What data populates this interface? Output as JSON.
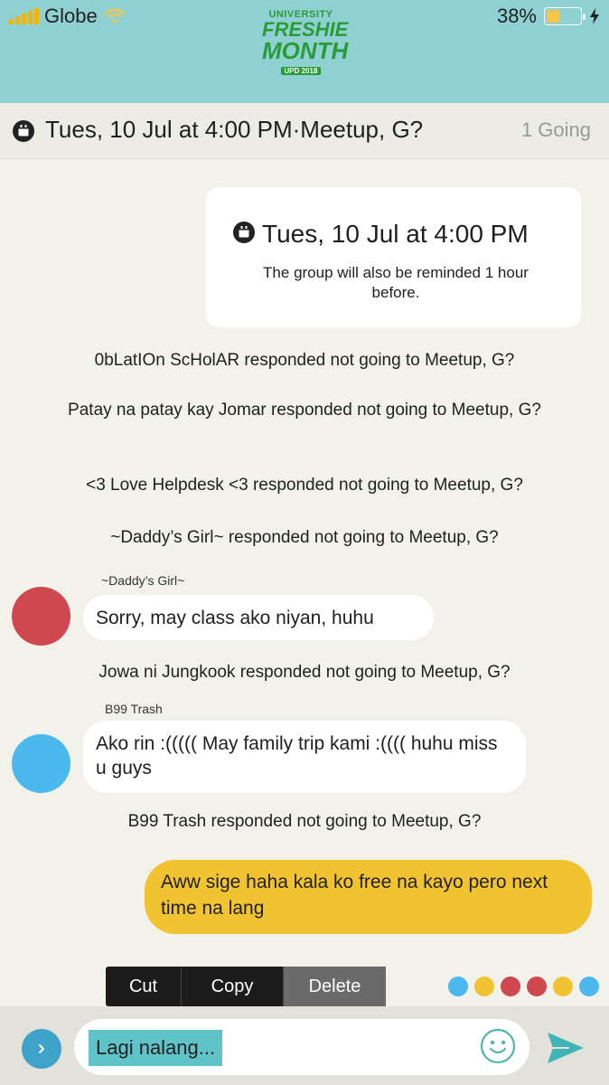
{
  "status_bar": {
    "carrier": "Globe",
    "battery": "38%",
    "battery_level": 0.38
  },
  "header": {
    "logo_lines": [
      "UNIVERSITY",
      "FRESHIE",
      "MONTH",
      "UPD 2018"
    ]
  },
  "event_bar": {
    "title": "Tues, 10 Jul at 4:00 PM·Meetup, G?",
    "going": "1 Going"
  },
  "event_card": {
    "datetime": "Tues, 10 Jul at 4:00 PM",
    "note": "The group will also be reminded 1 hour before."
  },
  "messages": {
    "sys1": "0bLatIOn ScHolAR responded not going to Meetup, G?",
    "sys2": "Patay na patay kay Jomar responded not going to Meetup, G?",
    "sys3": "<3 Love Helpdesk <3 responded not going to Meetup, G?",
    "sys4": "~Daddy’s Girl~ responded not going to Meetup, G?",
    "msg1_sender": "~Daddy’s Girl~",
    "msg1_text": "Sorry, may class ako niyan, huhu",
    "sys5": "Jowa ni Jungkook responded not going to Meetup, G?",
    "msg2_sender": "B99 Trash",
    "msg2_text": "Ako rin :((((( May family trip kami :(((( huhu miss u guys",
    "sys6": "B99 Trash responded not going to Meetup, G?",
    "mine_text": "Aww sige haha kala ko free na kayo pero next time na lang"
  },
  "colors": {
    "avatar1": "#d0484f",
    "avatar2": "#4bb8ee",
    "mine_bubble": "#f2c331",
    "header_bg": "#8fd1d3"
  },
  "context_menu": {
    "cut": "Cut",
    "copy": "Copy",
    "delete": "Delete"
  },
  "reaction_dots": [
    "#4bb8ee",
    "#f2c331",
    "#d0484f",
    "#d0484f",
    "#f2c331",
    "#4bb8ee"
  ],
  "composer": {
    "text": "Lagi nalang...",
    "emoji_icon": "smiley-icon",
    "send_icon": "send-icon"
  }
}
